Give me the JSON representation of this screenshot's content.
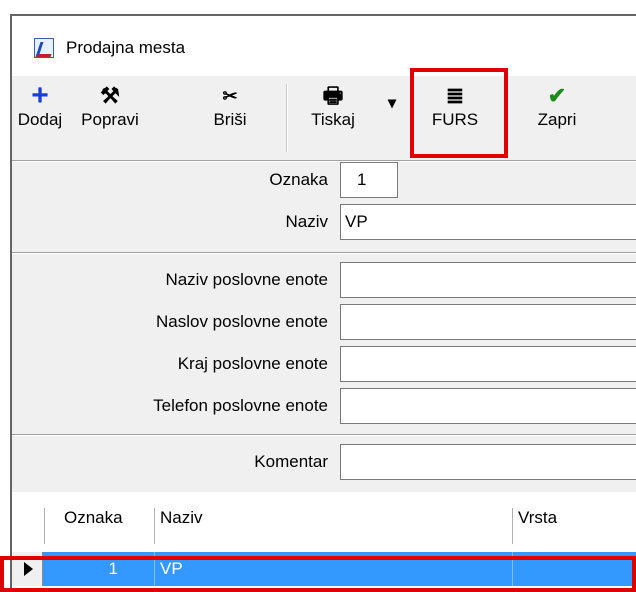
{
  "window": {
    "title": "Prodajna mesta"
  },
  "toolbar": {
    "buttons": [
      {
        "label": "Dodaj",
        "icon": "plus-icon",
        "glyph": "+",
        "color": "#1a3fd6"
      },
      {
        "label": "Popravi",
        "icon": "hammer-icon",
        "glyph": "⚒",
        "color": "#2a2a2a"
      },
      {
        "label": "Briši",
        "icon": "scissors-icon",
        "glyph": "✂",
        "color": "#2a2a2a"
      },
      {
        "label": "Tiskaj",
        "icon": "printer-icon",
        "glyph": "🖶",
        "color": "#2a2a2a"
      },
      {
        "label": "FURS",
        "icon": "furs-icon",
        "glyph": "≣",
        "color": "#2a2a2a"
      },
      {
        "label": "Zapri",
        "icon": "checkmark-icon",
        "glyph": "✔",
        "color": "#1a8a1a"
      }
    ],
    "dropdown_glyph": "▾"
  },
  "form": {
    "oznaka": {
      "label": "Oznaka",
      "value": "1"
    },
    "naziv": {
      "label": "Naziv",
      "value": "VP"
    },
    "naziv_poslovne_enote": {
      "label": "Naziv poslovne enote",
      "value": ""
    },
    "naslov_poslovne_enote": {
      "label": "Naslov poslovne enote",
      "value": ""
    },
    "kraj_poslovne_enote": {
      "label": "Kraj poslovne enote",
      "value": ""
    },
    "telefon_poslovne_enote": {
      "label": "Telefon poslovne enote",
      "value": ""
    },
    "komentar": {
      "label": "Komentar",
      "value": ""
    }
  },
  "grid": {
    "columns": [
      "Oznaka",
      "Naziv",
      "Vrsta"
    ],
    "rows": [
      {
        "oznaka": "1",
        "naziv": "VP",
        "vrsta": ""
      }
    ],
    "selected_color": "#3399ff"
  },
  "colors": {
    "highlight": "#e00000"
  }
}
